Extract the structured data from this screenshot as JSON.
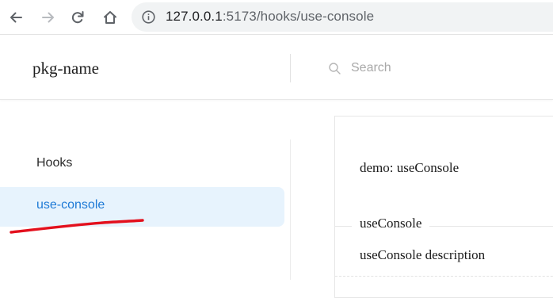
{
  "browser": {
    "url_host": "127.0.0.1",
    "url_rest": ":5173/hooks/use-console",
    "icons": {
      "back": "arrow-left-icon",
      "forward": "arrow-right-icon",
      "reload": "reload-icon",
      "home": "home-icon",
      "info": "info-icon"
    }
  },
  "header": {
    "site_title": "pkg-name",
    "search": {
      "placeholder": "Search",
      "icon": "search-icon"
    }
  },
  "sidebar": {
    "group_title": "Hooks",
    "items": [
      {
        "label": "use-console",
        "active": true
      }
    ],
    "accent_color": "#1e7ad6",
    "active_bg": "#e7f3fd"
  },
  "main": {
    "demo_title": "demo: useConsole",
    "section_title": "useConsole",
    "section_description": "useConsole description"
  },
  "annotation": {
    "color": "#e3101d"
  }
}
